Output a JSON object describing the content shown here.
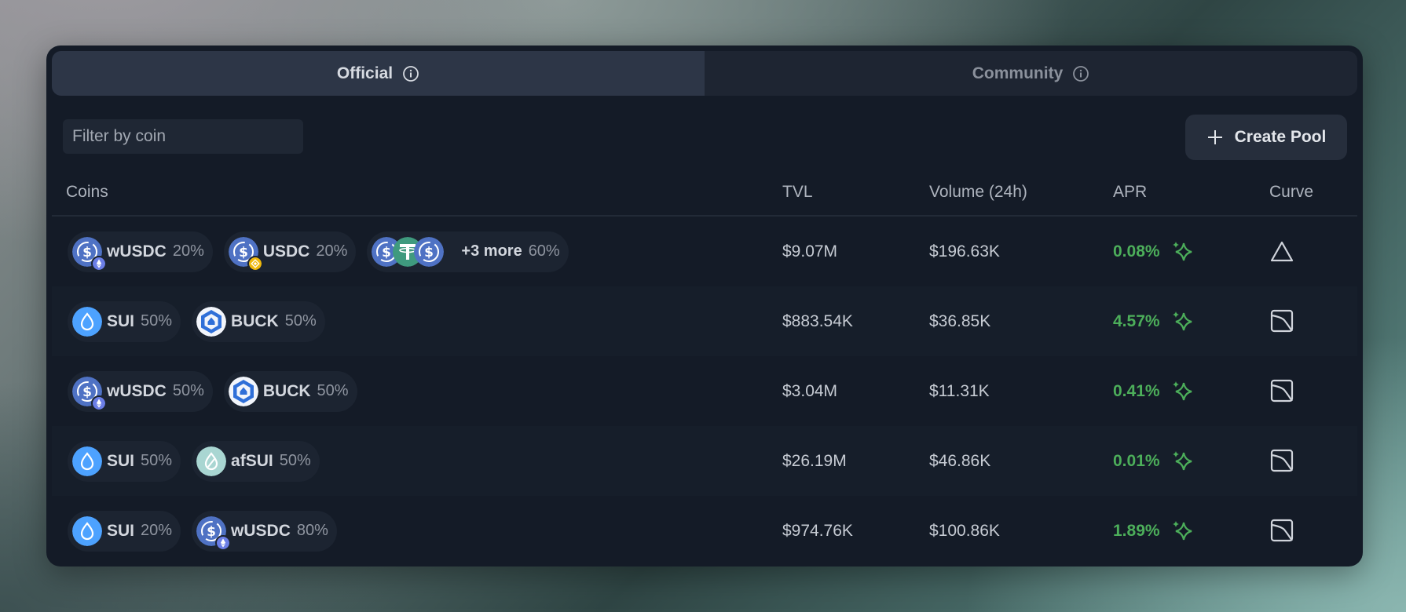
{
  "tabs": [
    {
      "label": "Official",
      "active": true
    },
    {
      "label": "Community",
      "active": false
    }
  ],
  "filter": {
    "placeholder": "Filter by coin"
  },
  "create_pool": {
    "label": "Create Pool"
  },
  "columns": {
    "coins": "Coins",
    "tvl": "TVL",
    "volume": "Volume (24h)",
    "apr": "APR",
    "curve": "Curve"
  },
  "rows": [
    {
      "coins": [
        {
          "symbol": "wUSDC",
          "pct": "20%",
          "icon": "usdc-icon",
          "badge": "eth-badge"
        },
        {
          "symbol": "USDC",
          "pct": "20%",
          "icon": "usdc-icon",
          "badge": "bnb-badge"
        },
        {
          "symbol": "+3 more",
          "pct": "60%",
          "icon": "stacked-usdc-usdt-usdc-icons"
        }
      ],
      "tvl": "$9.07M",
      "volume": "$196.63K",
      "apr": "0.08%",
      "curve": "triangle-icon"
    },
    {
      "coins": [
        {
          "symbol": "SUI",
          "pct": "50%",
          "icon": "sui-icon"
        },
        {
          "symbol": "BUCK",
          "pct": "50%",
          "icon": "buck-icon"
        }
      ],
      "tvl": "$883.54K",
      "volume": "$36.85K",
      "apr": "4.57%",
      "curve": "stable-curve-icon"
    },
    {
      "coins": [
        {
          "symbol": "wUSDC",
          "pct": "50%",
          "icon": "usdc-icon",
          "badge": "eth-badge"
        },
        {
          "symbol": "BUCK",
          "pct": "50%",
          "icon": "buck-icon"
        }
      ],
      "tvl": "$3.04M",
      "volume": "$11.31K",
      "apr": "0.41%",
      "curve": "stable-curve-icon"
    },
    {
      "coins": [
        {
          "symbol": "SUI",
          "pct": "50%",
          "icon": "sui-icon"
        },
        {
          "symbol": "afSUI",
          "pct": "50%",
          "icon": "afsui-icon"
        }
      ],
      "tvl": "$26.19M",
      "volume": "$46.86K",
      "apr": "0.01%",
      "curve": "stable-curve-icon"
    },
    {
      "coins": [
        {
          "symbol": "SUI",
          "pct": "20%",
          "icon": "sui-icon"
        },
        {
          "symbol": "wUSDC",
          "pct": "80%",
          "icon": "usdc-icon",
          "badge": "eth-badge"
        }
      ],
      "tvl": "$974.76K",
      "volume": "$100.86K",
      "apr": "1.89%",
      "curve": "stable-curve-icon"
    }
  ],
  "colors": {
    "apr_green": "#4cae5a",
    "usdc_blue": "#4f72c4",
    "sui_blue": "#4da2ff",
    "buck_blue": "#2f6fd8",
    "usdt_green": "#3f9a7e",
    "eth_purple": "#6b7ee6",
    "bnb_yellow": "#f0b90b",
    "afsui_teal": "#a9d6d2"
  }
}
